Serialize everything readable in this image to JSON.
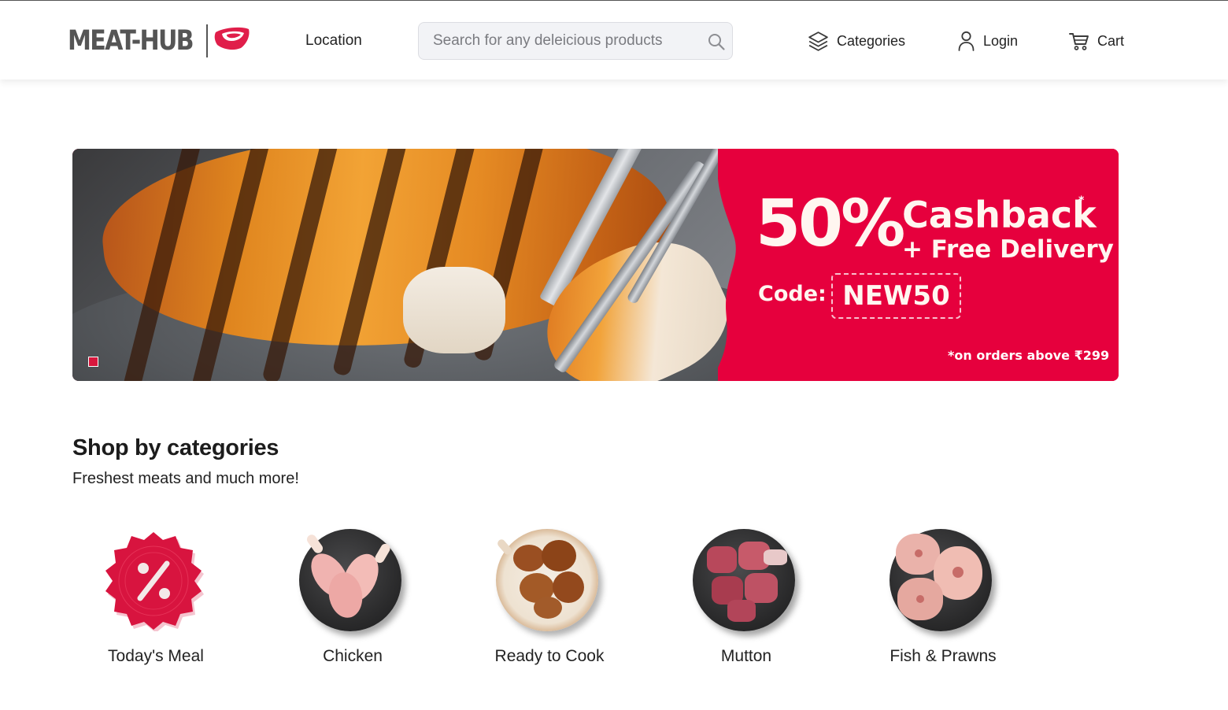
{
  "header": {
    "logo_text": "MEAT-HUB",
    "location_label": "Location",
    "search_placeholder": "Search for any deleicious products",
    "nav": {
      "categories": "Categories",
      "login": "Login",
      "cart": "Cart"
    }
  },
  "banner": {
    "percent": "50%",
    "cashback": "Cashback",
    "asterisk": "*",
    "free_delivery": "+ Free Delivery",
    "code_label": "Code:",
    "code": "NEW50",
    "terms": "*on orders above ₹299"
  },
  "categories": {
    "title": "Shop by categories",
    "subtitle": "Freshest meats and much more!",
    "items": [
      {
        "label": "Today's Meal"
      },
      {
        "label": "Chicken"
      },
      {
        "label": "Ready to Cook"
      },
      {
        "label": "Mutton"
      },
      {
        "label": "Fish & Prawns"
      }
    ]
  },
  "colors": {
    "brand_red": "#e6003d",
    "logo_gray": "#555555",
    "badge_red": "#d8143f"
  }
}
